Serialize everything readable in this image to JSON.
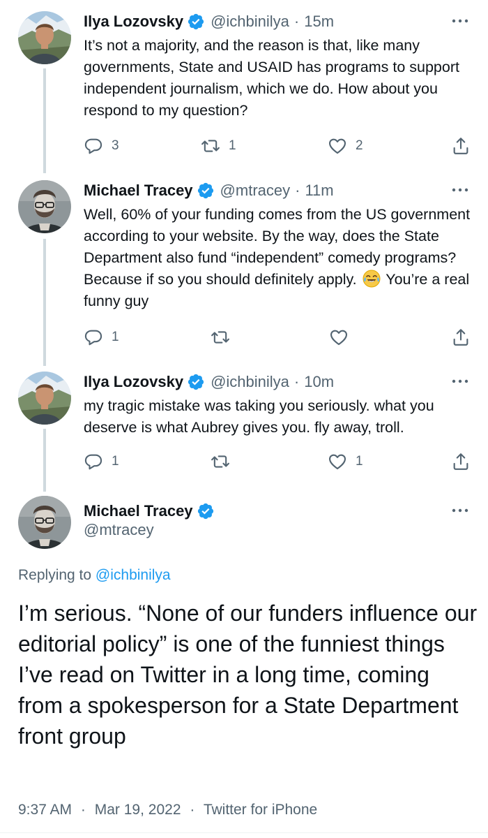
{
  "colors": {
    "verified": "#1d9bf0",
    "secondary_text": "#536471",
    "link": "#1d9bf0",
    "thread_line": "#cfd9de"
  },
  "tweets": [
    {
      "name": "Ilya Lozovsky",
      "handle": "@ichbinilya",
      "time": "15m",
      "text": "It’s not a majority, and the reason is that, like many governments, State and USAID has programs to support independent journalism, which we do. How about you respond to my question?",
      "replies": "3",
      "retweets": "1",
      "likes": "2"
    },
    {
      "name": "Michael Tracey",
      "handle": "@mtracey",
      "time": "11m",
      "text_before_emoji": "Well, 60% of your funding comes from the US government according to your website. By the way, does the State Department also fund “independent” comedy programs? Because if so you should definitely apply.",
      "emoji": "face-with-tears-of-joy",
      "text_after_emoji": "You’re a real funny guy",
      "replies": "1",
      "retweets": "",
      "likes": ""
    },
    {
      "name": "Ilya Lozovsky",
      "handle": "@ichbinilya",
      "time": "10m",
      "text": "my tragic mistake was taking you seriously. what you deserve is what Aubrey gives you. fly away, troll.",
      "replies": "1",
      "retweets": "",
      "likes": "1"
    }
  ],
  "main_tweet": {
    "name": "Michael Tracey",
    "handle": "@mtracey",
    "replying_prefix": "Replying to",
    "replying_to": "@ichbinilya",
    "text": "I’m serious. “None of our funders influence our editorial policy” is one of the funniest things I’ve read on Twitter in a long time, coming from a spokesperson for a State Department front group",
    "time": "9:37 AM",
    "date": "Mar 19, 2022",
    "source": "Twitter for iPhone",
    "separator": "·"
  },
  "icons": {
    "reply": "reply-icon",
    "retweet": "retweet-icon",
    "like": "heart-icon",
    "share": "share-icon",
    "more": "more-icon",
    "verified": "verified-badge-icon"
  }
}
